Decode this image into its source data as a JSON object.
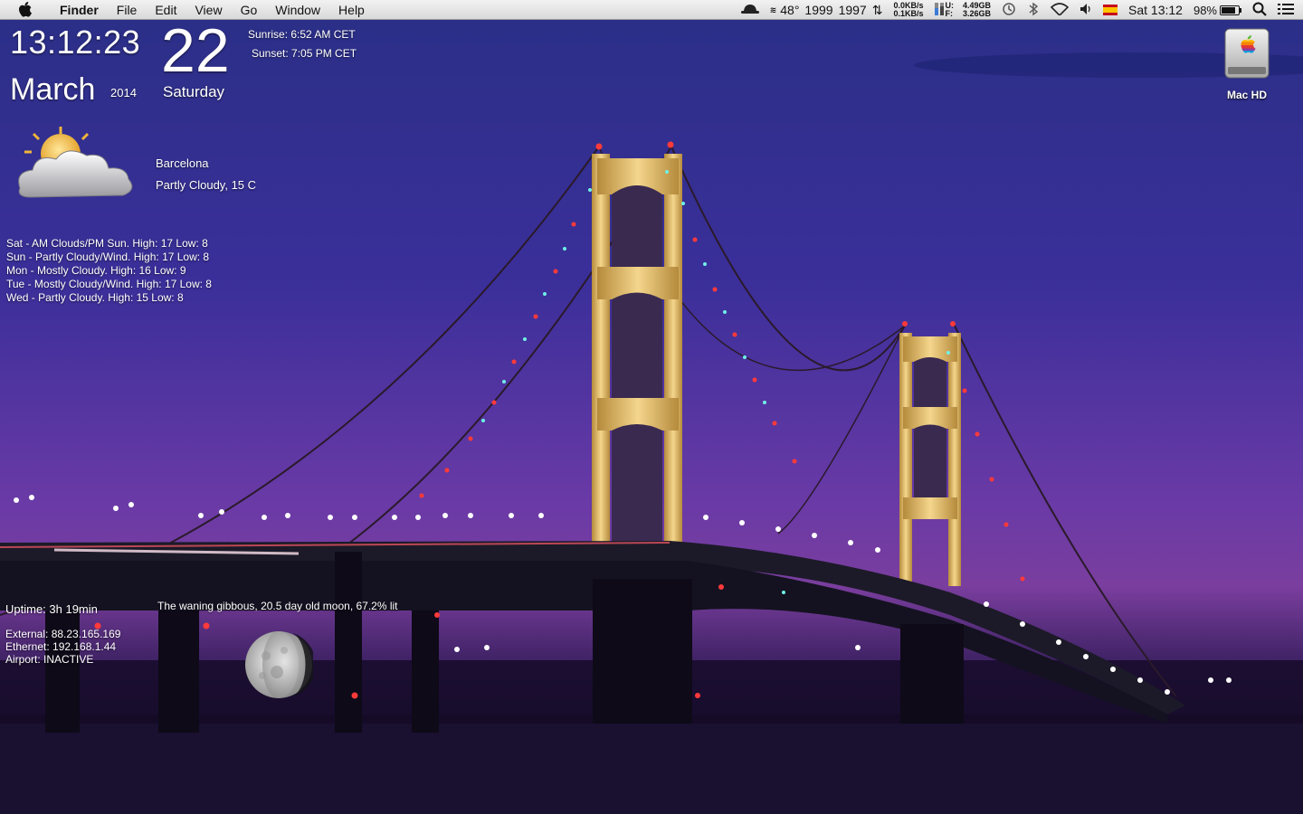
{
  "menubar": {
    "app_name": "Finder",
    "menus": [
      "File",
      "Edit",
      "View",
      "Go",
      "Window",
      "Help"
    ],
    "status": {
      "temperature": "48°",
      "fan_left": "1999",
      "fan_right": "1997",
      "net_up": "0.0KB/s",
      "net_down": "0.1KB/s",
      "mem_used_label": "U:",
      "mem_free_label": "F:",
      "mem_used": "4.49GB",
      "mem_free": "3.26GB",
      "battery_percent": "98%",
      "clock": "Sat 13:12"
    }
  },
  "clock": {
    "time": "13:12:23",
    "day": "22",
    "month": "March",
    "year": "2014",
    "weekday": "Saturday",
    "sunrise": "Sunrise: 6:52 AM CET",
    "sunset": "Sunset: 7:05 PM CET"
  },
  "weather": {
    "icon": "partly-cloudy-icon",
    "city": "Barcelona",
    "conditions": "Partly Cloudy, 15 C",
    "forecast": [
      "Sat - AM Clouds/PM Sun. High: 17 Low: 8",
      "Sun - Partly Cloudy/Wind. High: 17 Low: 8",
      "Mon - Mostly Cloudy. High: 16 Low: 9",
      "Tue - Mostly Cloudy/Wind. High: 17 Low: 8",
      "Wed - Partly Cloudy. High: 15 Low: 8"
    ]
  },
  "system": {
    "uptime": "Uptime: 3h 19min",
    "external": "External: 88.23.165.169",
    "ethernet": "Ethernet: 192.168.1.44",
    "airport": "Airport: INACTIVE"
  },
  "moon": {
    "text": "The waning gibbous, 20.5 day old moon, 67.2% lit"
  },
  "desktop": {
    "drive_label": "Mac HD"
  }
}
